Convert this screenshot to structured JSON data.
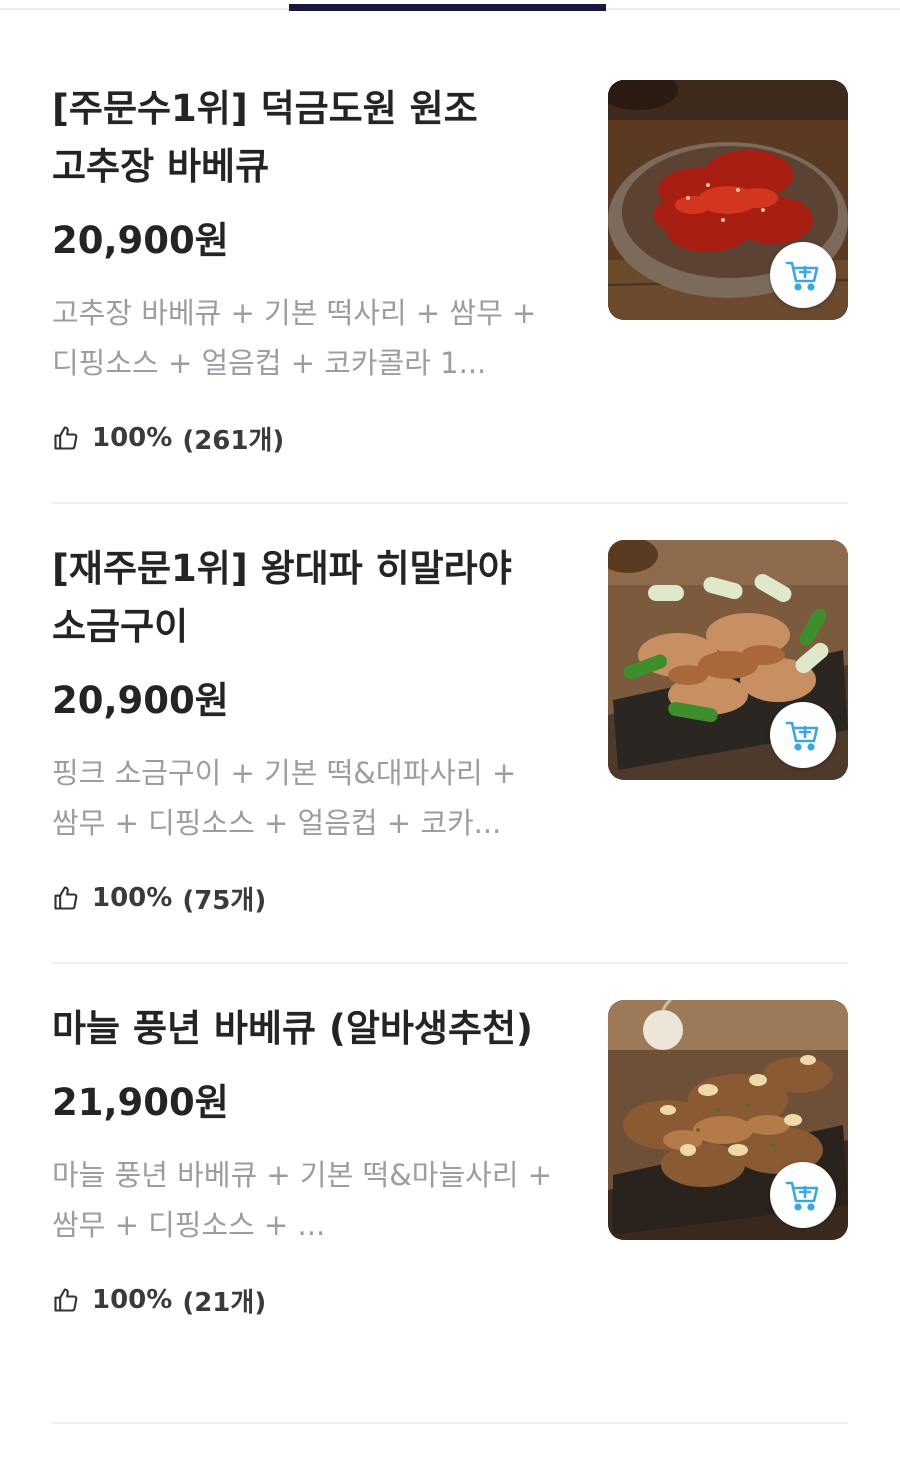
{
  "menu": {
    "items": [
      {
        "title": "[주문수1위] 덕금도원 원조 고추장 바베큐",
        "price": "20,900원",
        "description": "고추장 바베큐 + 기본 떡사리 + 쌈무 + 디핑소스 + 얼음컵 + 코카콜라 1...",
        "rating_percent": "100%",
        "review_count": "(261개)",
        "image_icon": "spicy-bbq-food-image",
        "cart_icon": "add-to-cart-icon"
      },
      {
        "title": "[재주문1위] 왕대파 히말라야 소금구이",
        "price": "20,900원",
        "description": "핑크 소금구이 + 기본 떡&대파사리 + 쌈무 + 디핑소스 + 얼음컵 + 코카...",
        "rating_percent": "100%",
        "review_count": "(75개)",
        "image_icon": "salt-grill-food-image",
        "cart_icon": "add-to-cart-icon"
      },
      {
        "title": "마늘 풍년 바베큐 (알바생추천)",
        "price": "21,900원",
        "description": "마늘 풍년 바베큐 + 기본 떡&마늘사리 + 쌈무 + 디핑소스 + ...",
        "rating_percent": "100%",
        "review_count": "(21개)",
        "image_icon": "garlic-bbq-food-image",
        "cart_icon": "add-to-cart-icon"
      }
    ]
  },
  "colors": {
    "tab_indicator": "#1b1840",
    "title": "#242424",
    "description": "#9a9ea3",
    "cart_icon": "#3aa8e0",
    "divider": "#efefef"
  }
}
